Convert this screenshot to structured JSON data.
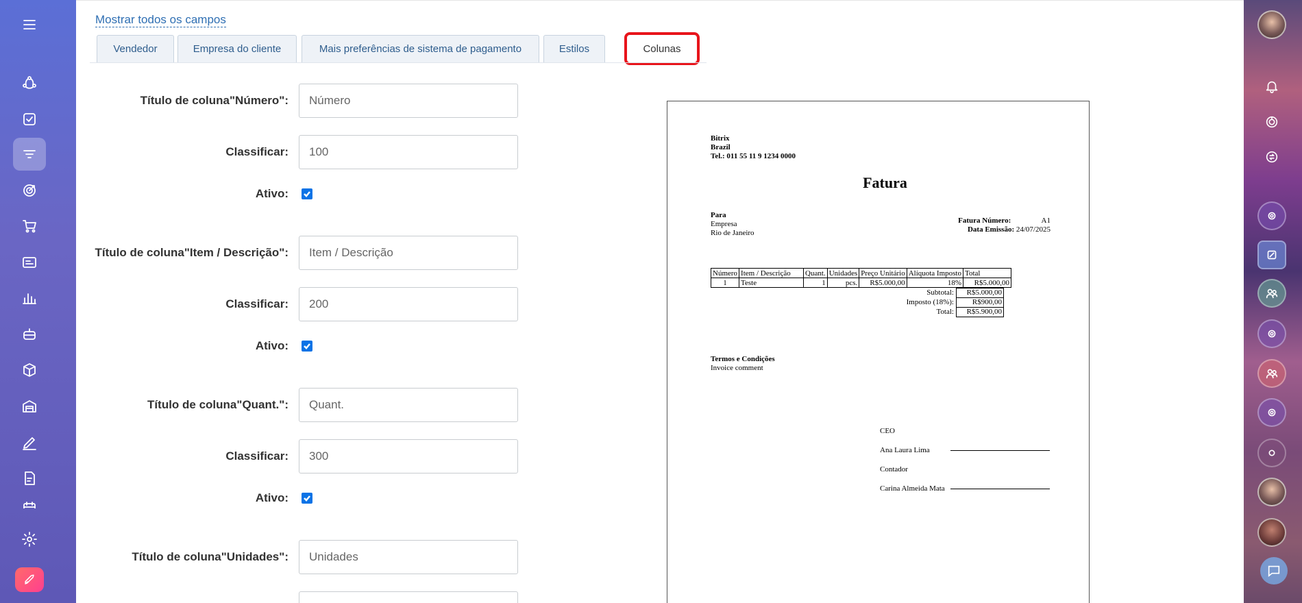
{
  "sidebar_left": {
    "icons": [
      "menu-icon",
      "crm-icon",
      "tasks-icon",
      "filter-icon",
      "target-icon",
      "cart-icon",
      "invoice-icon",
      "chart-icon",
      "robot-icon",
      "box-icon",
      "warehouse-icon",
      "sign-icon",
      "document-icon",
      "calendar-icon",
      "settings-icon",
      "rocket-icon"
    ],
    "active": "filter-icon"
  },
  "show_all_fields": "Mostrar todos os campos",
  "tabs": [
    {
      "label": "Vendedor"
    },
    {
      "label": "Empresa do cliente"
    },
    {
      "label": "Mais preferências de sistema de pagamento"
    },
    {
      "label": "Estilos"
    },
    {
      "label": "Colunas",
      "active": true
    }
  ],
  "form": {
    "rows": [
      {
        "label": "Título de coluna\"Número\":",
        "value": "Número"
      },
      {
        "label": "Classificar:",
        "value": "100"
      },
      {
        "label": "Ativo:",
        "checked": true
      },
      {
        "label": "Título de coluna\"Item / Descrição\":",
        "value": "Item / Descrição"
      },
      {
        "label": "Classificar:",
        "value": "200"
      },
      {
        "label": "Ativo:",
        "checked": true
      },
      {
        "label": "Título de coluna\"Quant.\":",
        "value": "Quant."
      },
      {
        "label": "Classificar:",
        "value": "300"
      },
      {
        "label": "Ativo:",
        "checked": true
      },
      {
        "label": "Título de coluna\"Unidades\":",
        "value": "Unidades"
      }
    ]
  },
  "invoice": {
    "seller_name": "Bitrix",
    "seller_country": "Brazil",
    "seller_phone": "Tel.: 011 55 11 9 1234 0000",
    "title": "Fatura",
    "to_label": "Para",
    "to_company": "Empresa",
    "to_city": "Rio de Janeiro",
    "number_label": "Fatura Número:",
    "number_value": "A1",
    "date_label": "Data Emissão:",
    "date_value": "24/07/2025",
    "table_headers": [
      "Número",
      "Item / Descrição",
      "Quant.",
      "Unidades",
      "Preço Unitário",
      "Alíquota Imposto",
      "Total"
    ],
    "table_row": [
      "1",
      "Teste",
      "1",
      "pcs.",
      "R$5.000,00",
      "18%",
      "R$5.000,00"
    ],
    "subtotal_label": "Subtotal:",
    "subtotal_value": "R$5.000,00",
    "tax_label": "Imposto (18%):",
    "tax_value": "R$900,00",
    "total_label": "Total:",
    "total_value": "R$5.900,00",
    "terms_title": "Termos e Condições",
    "terms_text": "Invoice comment",
    "sign1_role": "CEO",
    "sign1_name": "Ana Laura Lima",
    "sign2_role": "Contador",
    "sign2_name": "Carina Almeida Mata"
  },
  "sidebar_right": {
    "icons": [
      "user-avatar",
      "bell-icon",
      "copilot-icon",
      "sync-icon",
      "group-chat",
      "channel-chat",
      "team-chat",
      "open-line",
      "contact-avatar",
      "group-avatar",
      "chat-icon"
    ]
  }
}
